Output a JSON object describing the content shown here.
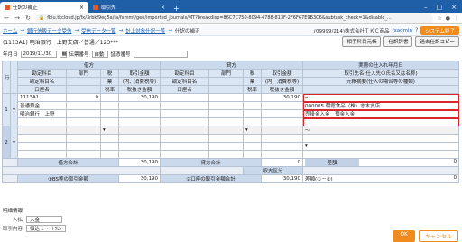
{
  "browser": {
    "tabs": [
      {
        "label": "仕訳の補正"
      },
      {
        "label": "取引先"
      }
    ],
    "url": "fbiu.tkcloud.jp/fx/3rbkf9eg5a/fa/fxmmt/gen/imported_journals/MT?breakdisp=86C7C750-8094-4788-813F-2F6F67E9B3C6&subtask_check=1&disable_..."
  },
  "breadcrumb": {
    "items": [
      "ホーム",
      "銀行信販データ受信",
      "受信データ一覧",
      "計上対象仕訳一覧"
    ],
    "current": "仕訳の補正",
    "company": "(09999/214)株式会社ＴＫＣ商品",
    "user": "fxadmin",
    "system_end": "システム終了"
  },
  "header": {
    "client": "(1113A1) 明治銀行　上野支店／普通／123***",
    "buttons": [
      "相手科目元帳",
      "仕訳辞書",
      "過去仕訳コピー"
    ]
  },
  "form": {
    "date_label": "年月日",
    "date_value": "2019/11/30",
    "voucher_type_label": "伝票番号",
    "voucher_type_value": "自動",
    "evidence_label": "証憑番号"
  },
  "table": {
    "col_row": "行",
    "debit": "借方",
    "credit": "貸方",
    "actual": "実際の仕入れ年月日",
    "h_account": "勘定科目",
    "h_dept": "部門",
    "h_tax": "税",
    "h_amount": "取引金額",
    "h_amount_sub": "(内、消費税等)",
    "h_account_name": "勘定科目名",
    "h_tax_type": "業",
    "h_partner": "取引先名(仕入先の氏名又は名称)",
    "h_code": "口座名",
    "h_rate": "税率",
    "h_tax_amount": "税抜き金額",
    "h_content": "元帳摘要(仕入の場合等の種類)",
    "rows": [
      {
        "no": "1",
        "d_account": "1113A1",
        "d_dept": "0",
        "d_amount": "30,190",
        "d_name": "普通預金",
        "d_bank": "明治銀行　上野",
        "c_amount": "30,190",
        "partner_code": "000005",
        "partner_name": "朝霞食品（株）志木支店",
        "summary_1": "売掛金入金",
        "summary_2": "預金入金",
        "tilde": "～"
      },
      {
        "no": "2"
      }
    ],
    "sum_debit_label": "借方合計",
    "sum_debit": "30,190",
    "sum_credit_label": "貸方合計",
    "sum_credit": "30,190",
    "sum_credit2": "0",
    "diff_label": "差額",
    "diff": "0",
    "receive_label": "収支区分",
    "bank_total_label": "①BS等の取引金額",
    "bank_total": "30,190",
    "other_total_label": "②口座の取引金額合計",
    "other_total": "30,190",
    "diff2_label": "差額(①－②)",
    "diff2": "0"
  },
  "detail": {
    "title": "明細情報",
    "in_out_label": "入払",
    "in_out_value": "入金",
    "content_label": "取引内容",
    "content_value": "振込１・ｲﾄｳﾋﾝ"
  },
  "buttons": {
    "ok": "OK",
    "cancel": "キャンセル"
  }
}
